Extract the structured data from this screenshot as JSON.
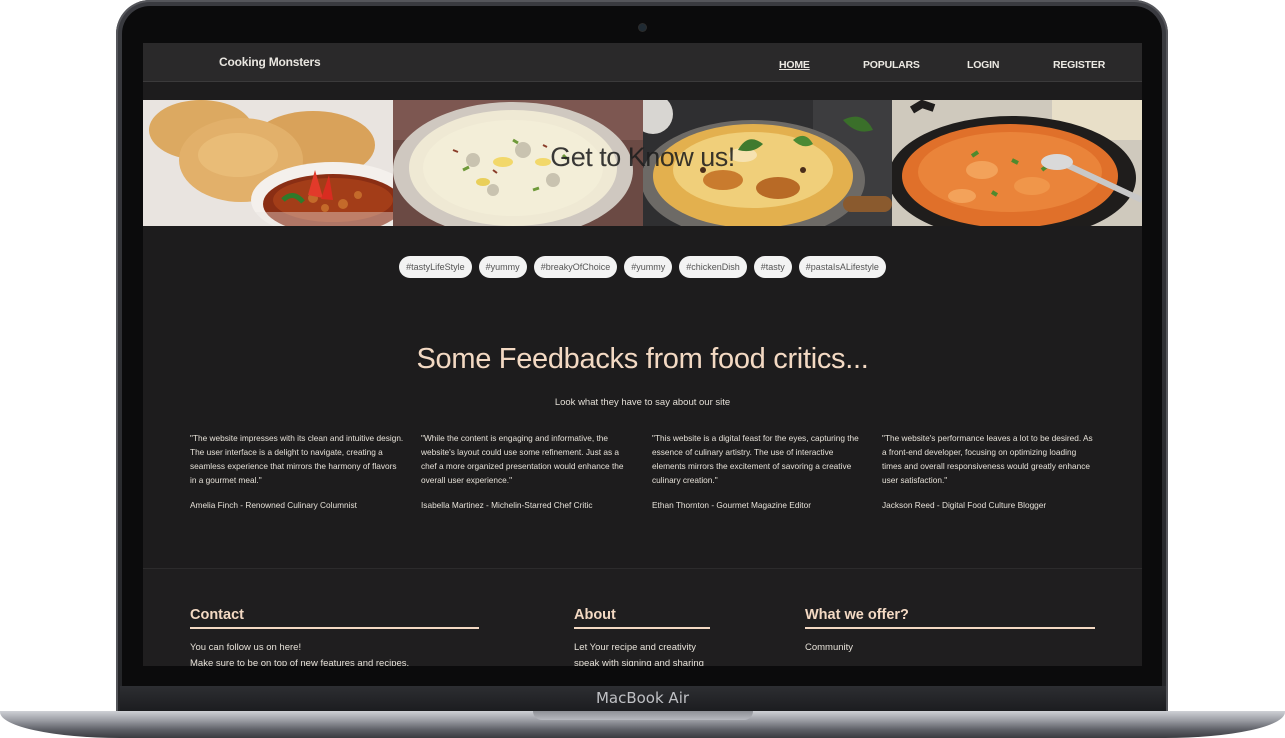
{
  "device": {
    "label": "MacBook Air"
  },
  "navbar": {
    "brand": "Cooking Monsters",
    "links": [
      "HOME",
      "POPULARS",
      "LOGIN",
      "REGISTER"
    ]
  },
  "hero": {
    "title": "Get to Know us!"
  },
  "tags": [
    "#tastyLifeStyle",
    "#yummy",
    "#breakyOfChoice",
    "#yummy",
    "#chickenDish",
    "#tasty",
    "#pastaIsALifestyle"
  ],
  "feedback": {
    "title": "Some Feedbacks from food critics...",
    "subtitle": "Look what they have to say about our site",
    "reviews": [
      {
        "quote": "\"The website impresses with its clean and intuitive design. The user interface is a delight to navigate, creating a seamless experience that mirrors the harmony of flavors in a gourmet meal.\"",
        "author": "Amelia Finch - Renowned Culinary Columnist"
      },
      {
        "quote": "\"While the content is engaging and informative, the website's layout could use some refinement. Just as a chef a more organized presentation would enhance the overall user experience.\"",
        "author": "Isabella Martinez - Michelin-Starred Chef Critic"
      },
      {
        "quote": "\"This website is a digital feast for the eyes, capturing the essence of culinary artistry. The use of interactive elements mirrors the excitement of savoring a creative culinary creation.\"",
        "author": "Ethan Thornton - Gourmet Magazine Editor"
      },
      {
        "quote": "\"The website's performance leaves a lot to be desired. As a front-end developer, focusing on optimizing loading times and overall responsiveness would greatly enhance user satisfaction.\"",
        "author": "Jackson Reed - Digital Food Culture Blogger"
      }
    ]
  },
  "footer": {
    "contact": {
      "heading": "Contact",
      "line1": "You can follow us on here!",
      "line2": "Make sure to be on top of new features and recipes."
    },
    "about": {
      "heading": "About",
      "line1": "Let Your recipe and creativity",
      "line2": "speak with signing and sharing"
    },
    "offer": {
      "heading": "What we offer?",
      "line1": "Community"
    }
  }
}
